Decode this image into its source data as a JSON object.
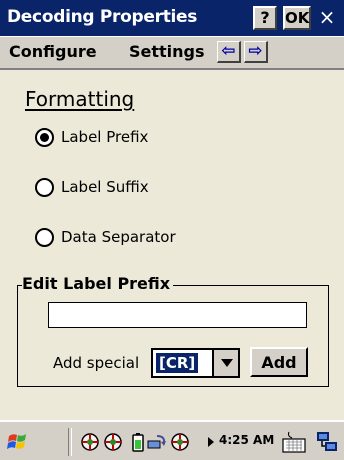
{
  "window": {
    "title": "Decoding Properties",
    "help_label": "?",
    "ok_label": "OK",
    "close_label": "×"
  },
  "menu": {
    "configure": "Configure",
    "settings": "Settings",
    "prev_arrow": "⇦",
    "next_arrow": "⇨"
  },
  "formatting": {
    "title": "Formatting",
    "options": [
      {
        "label": "Label Prefix",
        "checked": true
      },
      {
        "label": "Label Suffix",
        "checked": false
      },
      {
        "label": "Data Separator",
        "checked": false
      }
    ]
  },
  "edit_group": {
    "legend": "Edit Label Prefix",
    "input_value": "",
    "add_special_label": "Add special",
    "special_selected": "[CR]",
    "add_button": "Add"
  },
  "taskbar": {
    "time": "4:25 AM",
    "icons": [
      "start-flag-icon",
      "ball-icon",
      "ball-icon",
      "battery-icon",
      "sync-icon",
      "ball-icon",
      "keyboard-icon",
      "network-icon"
    ]
  },
  "colors": {
    "titlebar": "#0a246a",
    "face": "#d4d0c8",
    "background": "#ece9d8",
    "selection": "#0a246a"
  }
}
